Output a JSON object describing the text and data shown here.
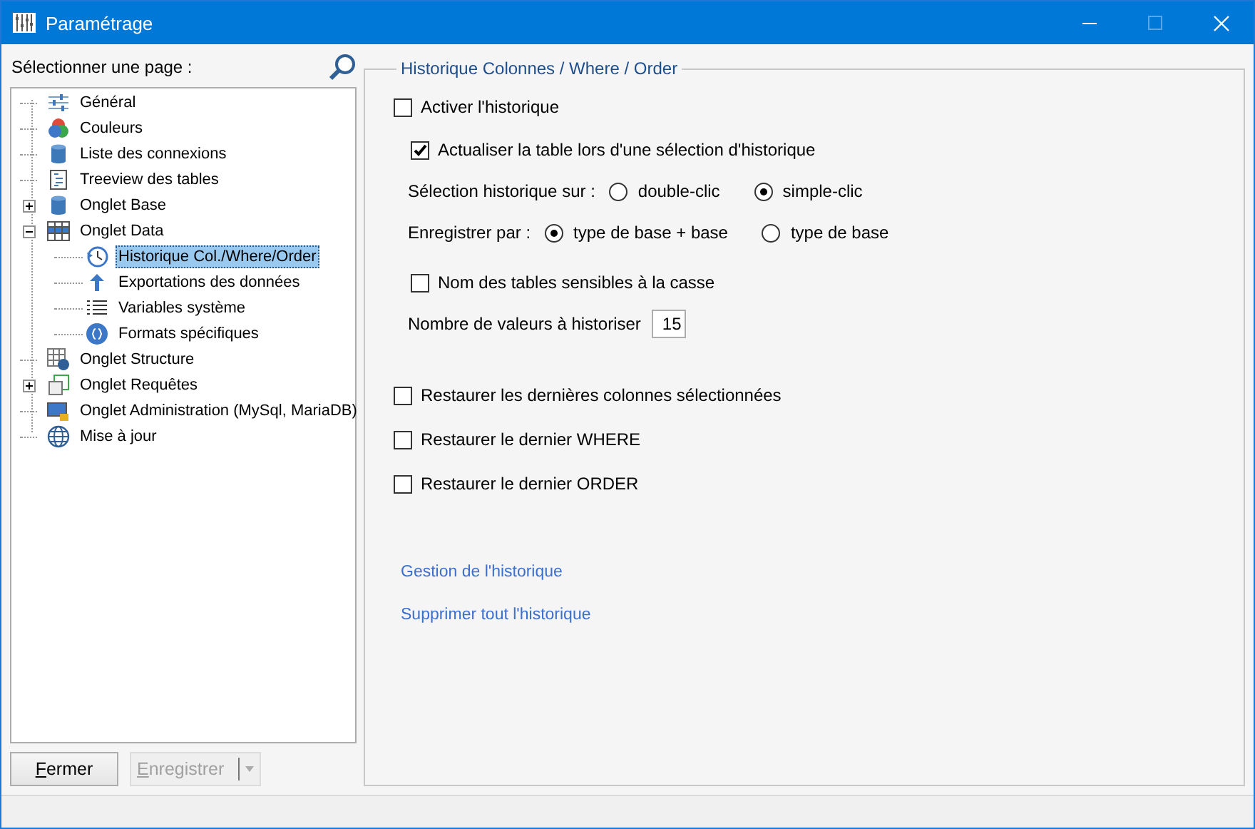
{
  "window": {
    "title": "Paramétrage",
    "maximize_disabled": true
  },
  "sidebar": {
    "label": "Sélectionner une page :",
    "tree": [
      {
        "label": "Général",
        "selected": false
      },
      {
        "label": "Couleurs",
        "selected": false
      },
      {
        "label": "Liste des connexions",
        "selected": false
      },
      {
        "label": "Treeview des tables",
        "selected": false
      },
      {
        "label": "Onglet Base",
        "selected": false,
        "expanded": false
      },
      {
        "label": "Onglet Data",
        "selected": false,
        "expanded": true,
        "children": [
          {
            "label": "Historique Col./Where/Order",
            "selected": true
          },
          {
            "label": "Exportations des données",
            "selected": false
          },
          {
            "label": "Variables système",
            "selected": false
          },
          {
            "label": "Formats spécifiques",
            "selected": false
          }
        ]
      },
      {
        "label": "Onglet Structure",
        "selected": false
      },
      {
        "label": "Onglet Requêtes",
        "selected": false,
        "expanded": false
      },
      {
        "label": "Onglet Administration (MySql, MariaDB)",
        "selected": false
      },
      {
        "label": "Mise à jour",
        "selected": false
      }
    ]
  },
  "buttons": [
    {
      "label": "Fermer",
      "disabled": false,
      "dropdown": false
    },
    {
      "label": "Enregistrer",
      "disabled": true,
      "dropdown": true
    }
  ],
  "group": {
    "title": "Historique Colonnes / Where / Order",
    "activate": {
      "label": "Activer l'historique",
      "checked": false
    },
    "sub_options": [
      {
        "kind": "checkbox",
        "label": "Actualiser la table lors d'une sélection d'historique",
        "checked": true
      },
      {
        "kind": "radio",
        "label": "Sélection historique sur :",
        "options": [
          {
            "label": "double-clic",
            "selected": false
          },
          {
            "label": "simple-clic",
            "selected": true
          }
        ]
      },
      {
        "kind": "radio",
        "label": "Enregistrer par :",
        "options": [
          {
            "label": "type de base + base",
            "selected": true
          },
          {
            "label": "type de base",
            "selected": false
          }
        ]
      },
      {
        "kind": "checkbox",
        "label": "Nom des tables sensibles à la casse",
        "checked": false
      },
      {
        "kind": "number",
        "label": "Nombre de valeurs à historiser",
        "value": "15"
      }
    ],
    "restore_options": [
      {
        "label": "Restaurer les dernières colonnes sélectionnées",
        "checked": false
      },
      {
        "label": "Restaurer le dernier WHERE",
        "checked": false
      },
      {
        "label": "Restaurer le dernier ORDER",
        "checked": false
      }
    ],
    "links": [
      "Gestion de l'historique",
      "Supprimer tout l'historique"
    ]
  }
}
